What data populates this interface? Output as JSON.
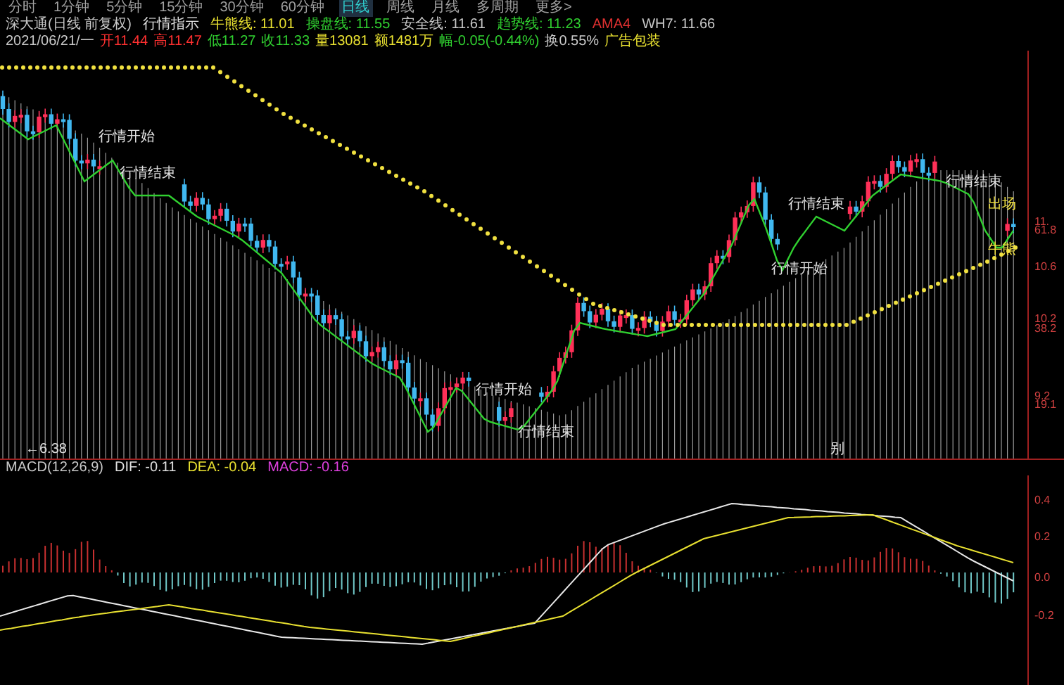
{
  "toolbar": {
    "periods": [
      {
        "label": "分时",
        "selected": false
      },
      {
        "label": "1分钟",
        "selected": false
      },
      {
        "label": "5分钟",
        "selected": false
      },
      {
        "label": "15分钟",
        "selected": false
      },
      {
        "label": "30分钟",
        "selected": false
      },
      {
        "label": "60分钟",
        "selected": false
      },
      {
        "label": "日线",
        "selected": true
      },
      {
        "label": "周线",
        "selected": false
      },
      {
        "label": "月线",
        "selected": false
      },
      {
        "label": "多周期",
        "selected": false
      },
      {
        "label": "更多>",
        "selected": false
      }
    ]
  },
  "header": {
    "title": "深大通(日线 前复权)",
    "indicator": "行情指示",
    "values": [
      {
        "text": "牛熊线: 11.01",
        "color": "#e8e030"
      },
      {
        "text": "操盘线: 11.55",
        "color": "#30d030"
      },
      {
        "text": "安全线: 11.61",
        "color": "#c8c8c8"
      },
      {
        "text": "趋势线: 11.23",
        "color": "#30d030"
      },
      {
        "text": "AMA4",
        "color": "#e03030"
      },
      {
        "text": "WH7: 11.66",
        "color": "#c8c8c8"
      }
    ]
  },
  "quote": [
    {
      "text": "2021/06/21/一",
      "color": "#c8c8c8"
    },
    {
      "text": "开11.44",
      "color": "#ff3030"
    },
    {
      "text": "高11.47",
      "color": "#ff3030"
    },
    {
      "text": "低11.27",
      "color": "#30d030"
    },
    {
      "text": "收11.33",
      "color": "#30d030"
    },
    {
      "text": "量13081",
      "color": "#e8e030"
    },
    {
      "text": "额1481万",
      "color": "#e8e030"
    },
    {
      "text": "幅-0.05(-0.44%)",
      "color": "#30d030"
    },
    {
      "text": "换0.55%",
      "color": "#c8c8c8"
    },
    {
      "text": "广告包装",
      "color": "#e8e030"
    }
  ],
  "chart": {
    "annotations": [
      {
        "text": "行情开始"
      },
      {
        "text": "行情结束"
      },
      {
        "text": "行情开始"
      },
      {
        "text": "行情结束"
      },
      {
        "text": "行情结束"
      },
      {
        "text": "行情开始"
      },
      {
        "text": "行情结束"
      },
      {
        "text": "出场"
      },
      {
        "text": "牛熊"
      },
      {
        "text": "←6.38"
      },
      {
        "text": "别"
      }
    ],
    "axis_labels": [
      "11.",
      "61.8",
      "10.6",
      "10.2",
      "38.2",
      "9.2",
      "19.1"
    ]
  },
  "macd": {
    "title": "MACD(12,26,9)",
    "values": [
      {
        "text": "DIF: -0.11",
        "color": "#e0e0e0"
      },
      {
        "text": "DEA: -0.04",
        "color": "#e8e030"
      },
      {
        "text": "MACD: -0.16",
        "color": "#e040e0"
      }
    ],
    "axis_labels": [
      "0.4",
      "0.2",
      "0.0",
      "-0.2"
    ]
  }
}
